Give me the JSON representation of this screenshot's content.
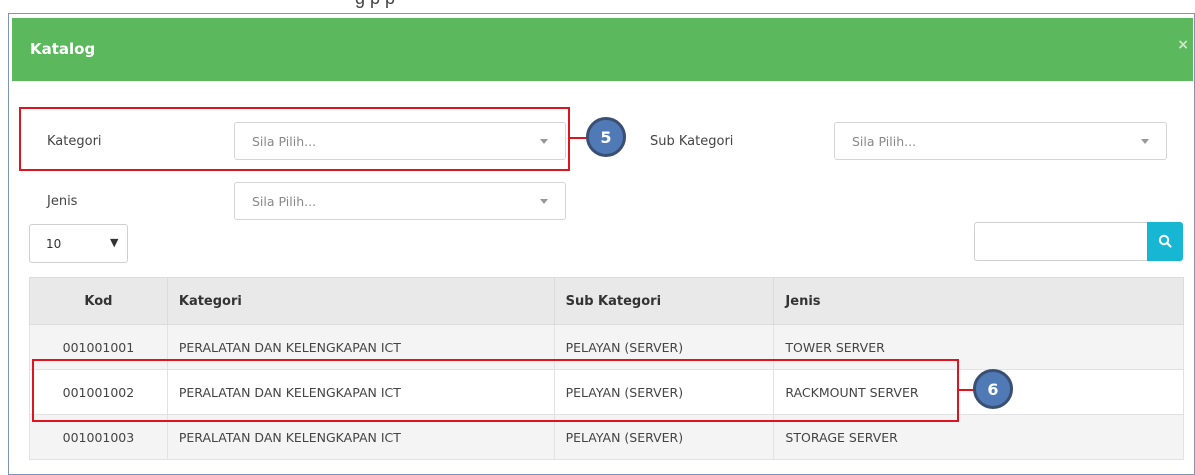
{
  "page": {
    "top_text": "g        p p"
  },
  "modal": {
    "title": "Katalog",
    "close_label": "×"
  },
  "filters": {
    "kategori": {
      "label": "Kategori",
      "placeholder": "Sila Pilih..."
    },
    "sub_kategori": {
      "label": "Sub Kategori",
      "placeholder": "Sila Pilih..."
    },
    "jenis": {
      "label": "Jenis",
      "placeholder": "Sila Pilih..."
    }
  },
  "page_length": {
    "value": "10",
    "arrow": "▼"
  },
  "search": {
    "placeholder": "",
    "icon": "search-icon"
  },
  "table": {
    "headers": [
      "Kod",
      "Kategori",
      "Sub Kategori",
      "Jenis"
    ],
    "rows": [
      [
        "001001001",
        "PERALATAN DAN KELENGKAPAN ICT",
        "PELAYAN (SERVER)",
        "TOWER SERVER"
      ],
      [
        "001001002",
        "PERALATAN DAN KELENGKAPAN ICT",
        "PELAYAN (SERVER)",
        "RACKMOUNT SERVER"
      ],
      [
        "001001003",
        "PERALATAN DAN KELENGKAPAN ICT",
        "PELAYAN (SERVER)",
        "STORAGE SERVER"
      ]
    ]
  },
  "annotations": {
    "callout_5": "5",
    "callout_6": "6"
  },
  "colors": {
    "header_green": "#5cb85c",
    "search_button": "#17b7d3",
    "highlight_red": "#e0141e",
    "callout_blue": "#4f7ab5"
  }
}
